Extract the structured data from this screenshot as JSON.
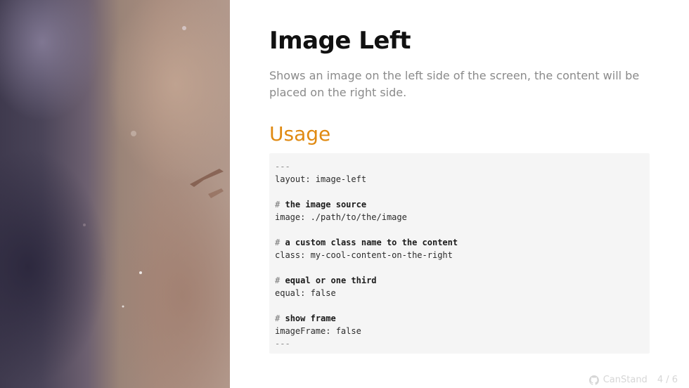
{
  "slide": {
    "title": "Image Left",
    "description": "Shows an image on the left side of the screen, the content will be placed on the right side.",
    "section_heading": "Usage"
  },
  "code": {
    "line_01": "---",
    "line_02": "layout: image-left",
    "line_03": "",
    "line_04_hash": "#",
    "line_04_comment": "the image source",
    "line_05": "image: ./path/to/the/image",
    "line_06": "",
    "line_07_hash": "#",
    "line_07_comment": "a custom class name to the content",
    "line_08": "class: my-cool-content-on-the-right",
    "line_09": "",
    "line_10_hash": "#",
    "line_10_comment": "equal or one third",
    "line_11": "equal: false",
    "line_12": "",
    "line_13_hash": "#",
    "line_13_comment": "show frame",
    "line_14": "imageFrame: false",
    "line_15": "---"
  },
  "footer": {
    "brand_icon": "github-icon",
    "brand_label": "CanStand",
    "page_indicator": "4 / 6"
  },
  "colors": {
    "accent": "#e08a12",
    "title": "#111111",
    "description": "#8a8a8a",
    "code_background": "#f5f5f5"
  }
}
